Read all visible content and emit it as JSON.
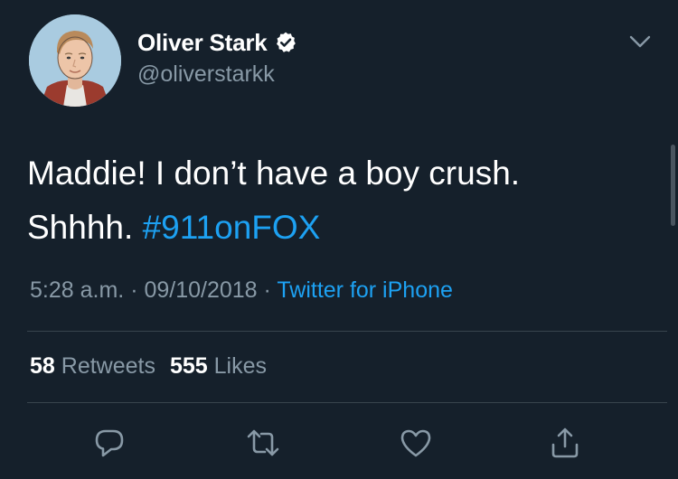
{
  "author": {
    "display_name": "Oliver Stark",
    "handle": "@oliverstarkk",
    "verified": true
  },
  "tweet": {
    "text_line1": "Maddie! I don’t have a boy crush.",
    "text_line2_prefix": "Shhhh. ",
    "hashtag": "#911onFOX",
    "time": "5:28 a.m.",
    "separator": "·",
    "date": "09/10/2018",
    "source": "Twitter for iPhone"
  },
  "stats": {
    "retweets_count": "58",
    "retweets_label": "Retweets",
    "likes_count": "555",
    "likes_label": "Likes"
  },
  "actions": [
    "reply-icon",
    "retweet-icon",
    "like-icon",
    "share-icon"
  ],
  "colors": {
    "background": "#15202b",
    "link": "#1da1f2",
    "secondary_text": "#8899a6",
    "divider": "#38444d"
  }
}
